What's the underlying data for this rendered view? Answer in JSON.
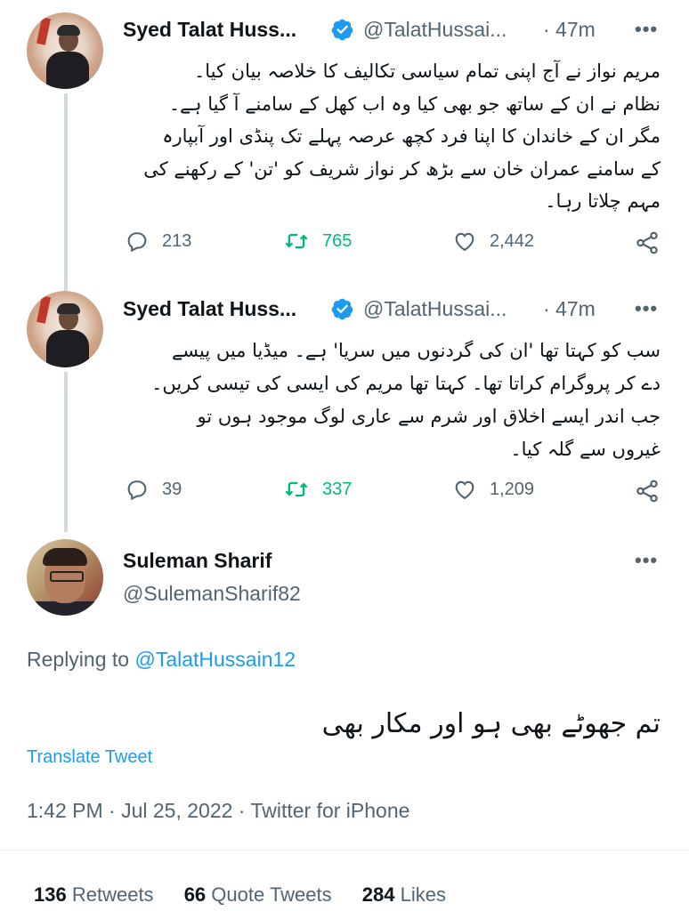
{
  "tweets": [
    {
      "name": "Syed Talat Huss...",
      "handle": "@TalatHussai...",
      "time": "· 47m",
      "more": "•••",
      "lines": [
        "مریم نواز نے آج اپنی تمام سیاسی تکالیف کا خلاصہ بیان کیا۔",
        "نظام نے ان کے ساتھ جو بھی کیا وہ اب کھل کے سامنے آ گیا ہے۔",
        "مگر ان کے خاندان کا اپنا فرد کچھ عرصہ پہلے تک پنڈی اور آبپارہ",
        "کے سامنے عمران خان سے بڑھ کر نواز شریف کو 'تن' کے رکھنے کی",
        "مہم چلاتا رہا۔"
      ],
      "replies": "213",
      "retweets": "765",
      "likes": "2,442"
    },
    {
      "name": "Syed Talat Huss...",
      "handle": "@TalatHussai...",
      "time": "· 47m",
      "more": "•••",
      "lines": [
        "سب کو کہتا تھا 'ان کی گردنوں میں سریا' ہے۔ میڈیا میں پیسے",
        "دے کر پروگرام کراتا تھا۔ کہتا تھا مریم کی ایسی کی تیسی کریں۔",
        "جب اندر ایسے اخلاق اور شرم سے عاری لوگ موجود ہوں تو",
        "غیروں سے گلہ کیا۔"
      ],
      "replies": "39",
      "retweets": "337",
      "likes": "1,209"
    }
  ],
  "main_tweet": {
    "name": "Suleman Sharif",
    "handle": "@SulemanSharif82",
    "more": "•••",
    "replying_prefix": "Replying to",
    "replying_mention": "@TalatHussain12",
    "text": "تم جھوٹے بھی ہو اور مکار بھی",
    "translate": "Translate Tweet",
    "meta": "1:42 PM · Jul 25, 2022 · Twitter for iPhone",
    "retweets_count": "136",
    "retweets_label": "Retweets",
    "quotes_count": "66",
    "quotes_label": "Quote Tweets",
    "likes_count": "284",
    "likes_label": "Likes"
  },
  "colors": {
    "text": "#0f1419",
    "secondary": "#536471",
    "accent": "#1d9bf0",
    "retweet": "#00ba7c",
    "thread_line": "#cfd9de"
  }
}
